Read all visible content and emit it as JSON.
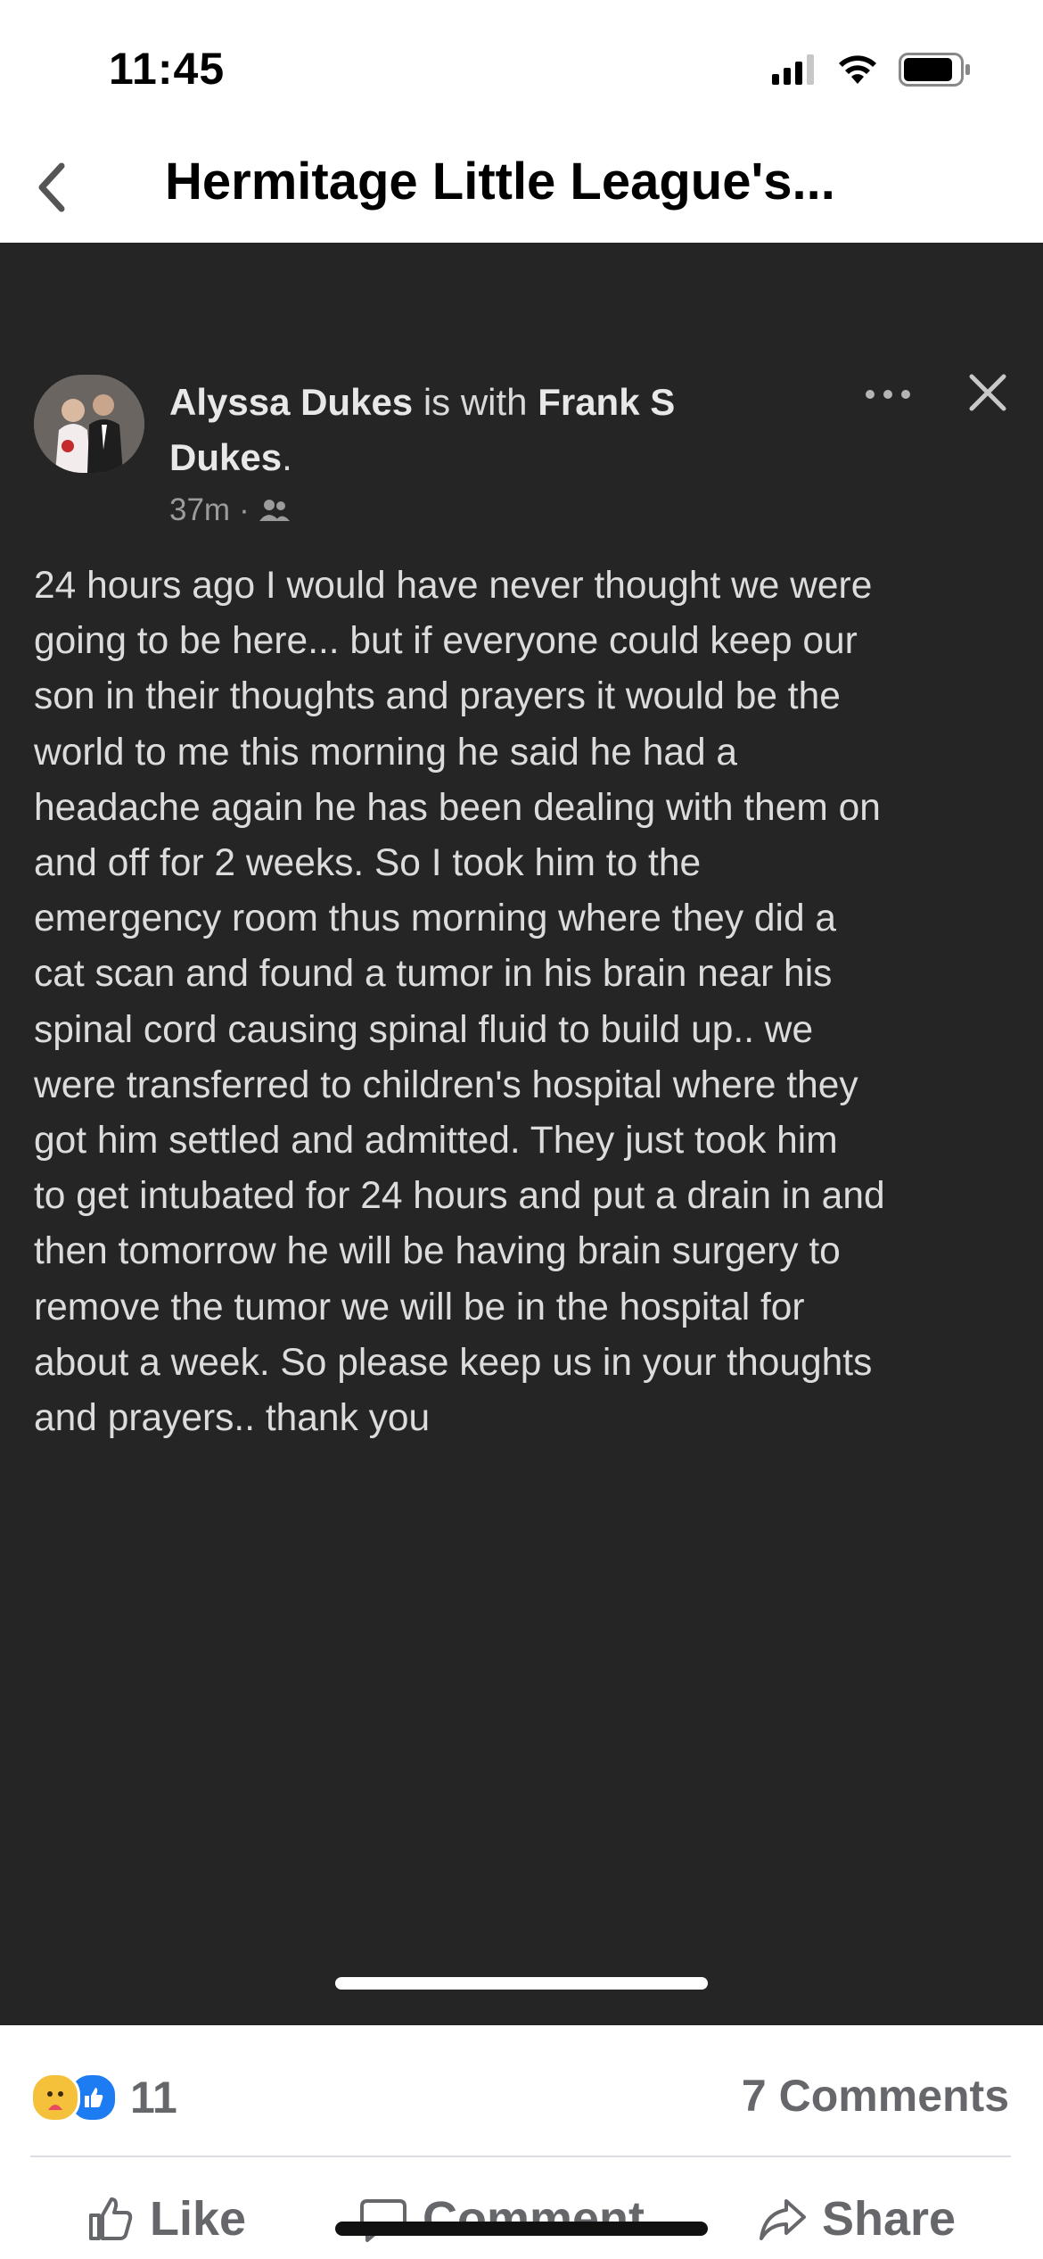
{
  "status_bar": {
    "time": "11:45"
  },
  "header": {
    "title": "Hermitage Little League's..."
  },
  "post": {
    "author": "Alyssa Dukes",
    "with_text": " is with ",
    "tagged": "Frank S Dukes",
    "tagged_suffix": ".",
    "time": "37m",
    "separator": "·",
    "privacy_icon": "friends-icon",
    "body": "24 hours ago I would have never thought we were\ngoing to be here... but if everyone could keep our\nson in their thoughts and prayers it would be the\nworld to me this morning he said he had a\nheadache again he has been dealing with them on\nand off for 2 weeks.  So I took him to the\nemergency room thus morning where they did a\ncat scan and found a tumor in his brain near his\nspinal cord causing spinal fluid to build up.. we\nwere transferred to children's hospital where they\ngot him settled and admitted.  They just took him\nto get intubated for 24 hours and put a drain in and\nthen tomorrow he will be having brain surgery to\nremove the tumor we will be in the hospital for\nabout a week. So please keep us in your thoughts\nand prayers.. thank you"
  },
  "footer": {
    "reaction_count": "11",
    "comments_count": "7 Comments",
    "actions": {
      "like": "Like",
      "comment": "Comment",
      "share": "Share"
    }
  },
  "colors": {
    "post_background": "#252526",
    "post_text": "#dcdcdc",
    "footer_text": "#65676b",
    "like_blue": "#1d7cf2",
    "care_yellow": "#f5c13a"
  }
}
